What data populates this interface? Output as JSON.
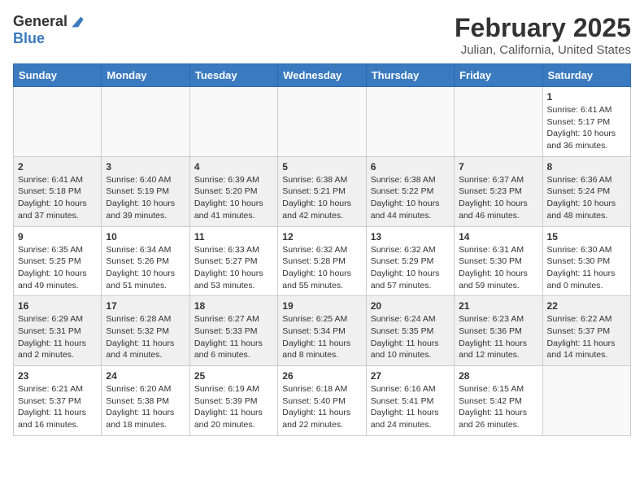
{
  "header": {
    "logo_general": "General",
    "logo_blue": "Blue",
    "title": "February 2025",
    "subtitle": "Julian, California, United States"
  },
  "weekdays": [
    "Sunday",
    "Monday",
    "Tuesday",
    "Wednesday",
    "Thursday",
    "Friday",
    "Saturday"
  ],
  "weeks": [
    [
      {
        "day": "",
        "info": ""
      },
      {
        "day": "",
        "info": ""
      },
      {
        "day": "",
        "info": ""
      },
      {
        "day": "",
        "info": ""
      },
      {
        "day": "",
        "info": ""
      },
      {
        "day": "",
        "info": ""
      },
      {
        "day": "1",
        "info": "Sunrise: 6:41 AM\nSunset: 5:17 PM\nDaylight: 10 hours and 36 minutes."
      }
    ],
    [
      {
        "day": "2",
        "info": "Sunrise: 6:41 AM\nSunset: 5:18 PM\nDaylight: 10 hours and 37 minutes."
      },
      {
        "day": "3",
        "info": "Sunrise: 6:40 AM\nSunset: 5:19 PM\nDaylight: 10 hours and 39 minutes."
      },
      {
        "day": "4",
        "info": "Sunrise: 6:39 AM\nSunset: 5:20 PM\nDaylight: 10 hours and 41 minutes."
      },
      {
        "day": "5",
        "info": "Sunrise: 6:38 AM\nSunset: 5:21 PM\nDaylight: 10 hours and 42 minutes."
      },
      {
        "day": "6",
        "info": "Sunrise: 6:38 AM\nSunset: 5:22 PM\nDaylight: 10 hours and 44 minutes."
      },
      {
        "day": "7",
        "info": "Sunrise: 6:37 AM\nSunset: 5:23 PM\nDaylight: 10 hours and 46 minutes."
      },
      {
        "day": "8",
        "info": "Sunrise: 6:36 AM\nSunset: 5:24 PM\nDaylight: 10 hours and 48 minutes."
      }
    ],
    [
      {
        "day": "9",
        "info": "Sunrise: 6:35 AM\nSunset: 5:25 PM\nDaylight: 10 hours and 49 minutes."
      },
      {
        "day": "10",
        "info": "Sunrise: 6:34 AM\nSunset: 5:26 PM\nDaylight: 10 hours and 51 minutes."
      },
      {
        "day": "11",
        "info": "Sunrise: 6:33 AM\nSunset: 5:27 PM\nDaylight: 10 hours and 53 minutes."
      },
      {
        "day": "12",
        "info": "Sunrise: 6:32 AM\nSunset: 5:28 PM\nDaylight: 10 hours and 55 minutes."
      },
      {
        "day": "13",
        "info": "Sunrise: 6:32 AM\nSunset: 5:29 PM\nDaylight: 10 hours and 57 minutes."
      },
      {
        "day": "14",
        "info": "Sunrise: 6:31 AM\nSunset: 5:30 PM\nDaylight: 10 hours and 59 minutes."
      },
      {
        "day": "15",
        "info": "Sunrise: 6:30 AM\nSunset: 5:30 PM\nDaylight: 11 hours and 0 minutes."
      }
    ],
    [
      {
        "day": "16",
        "info": "Sunrise: 6:29 AM\nSunset: 5:31 PM\nDaylight: 11 hours and 2 minutes."
      },
      {
        "day": "17",
        "info": "Sunrise: 6:28 AM\nSunset: 5:32 PM\nDaylight: 11 hours and 4 minutes."
      },
      {
        "day": "18",
        "info": "Sunrise: 6:27 AM\nSunset: 5:33 PM\nDaylight: 11 hours and 6 minutes."
      },
      {
        "day": "19",
        "info": "Sunrise: 6:25 AM\nSunset: 5:34 PM\nDaylight: 11 hours and 8 minutes."
      },
      {
        "day": "20",
        "info": "Sunrise: 6:24 AM\nSunset: 5:35 PM\nDaylight: 11 hours and 10 minutes."
      },
      {
        "day": "21",
        "info": "Sunrise: 6:23 AM\nSunset: 5:36 PM\nDaylight: 11 hours and 12 minutes."
      },
      {
        "day": "22",
        "info": "Sunrise: 6:22 AM\nSunset: 5:37 PM\nDaylight: 11 hours and 14 minutes."
      }
    ],
    [
      {
        "day": "23",
        "info": "Sunrise: 6:21 AM\nSunset: 5:37 PM\nDaylight: 11 hours and 16 minutes."
      },
      {
        "day": "24",
        "info": "Sunrise: 6:20 AM\nSunset: 5:38 PM\nDaylight: 11 hours and 18 minutes."
      },
      {
        "day": "25",
        "info": "Sunrise: 6:19 AM\nSunset: 5:39 PM\nDaylight: 11 hours and 20 minutes."
      },
      {
        "day": "26",
        "info": "Sunrise: 6:18 AM\nSunset: 5:40 PM\nDaylight: 11 hours and 22 minutes."
      },
      {
        "day": "27",
        "info": "Sunrise: 6:16 AM\nSunset: 5:41 PM\nDaylight: 11 hours and 24 minutes."
      },
      {
        "day": "28",
        "info": "Sunrise: 6:15 AM\nSunset: 5:42 PM\nDaylight: 11 hours and 26 minutes."
      },
      {
        "day": "",
        "info": ""
      }
    ]
  ]
}
